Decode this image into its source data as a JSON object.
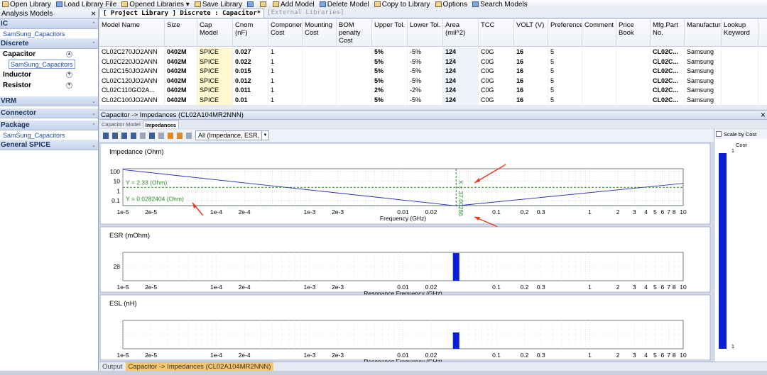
{
  "toolbar": {
    "items": [
      {
        "label": "Open Library",
        "icon": "folder-icon"
      },
      {
        "label": "Load Library File",
        "icon": "load-file-icon"
      },
      {
        "label": "Opened Libraries ▾",
        "icon": "libraries-icon"
      },
      {
        "label": "Save Library",
        "icon": "save-icon"
      },
      {
        "label": "",
        "icon": "split-view-icon"
      },
      {
        "label": "",
        "icon": "window-icon"
      },
      {
        "label": "Add Model",
        "icon": "add-model-icon"
      },
      {
        "label": "Delete Model",
        "icon": "delete-icon"
      },
      {
        "label": "Copy to Library",
        "icon": "copy-icon"
      },
      {
        "label": "Options",
        "icon": "options-icon"
      },
      {
        "label": "Search Models",
        "icon": "search-models-icon"
      }
    ]
  },
  "left": {
    "title": "Analysis Models",
    "close": "×",
    "groups": {
      "ic": {
        "label": "IC",
        "link": "SamSung_Capacitors"
      },
      "discrete": {
        "label": "Discrete",
        "capacitor": "Capacitor",
        "capacitor_link": "SamSung_Capacitors",
        "inductor": "Inductor",
        "resistor": "Resistor"
      },
      "vrm": {
        "label": "VRM"
      },
      "connector": {
        "label": "Connector"
      },
      "package": {
        "label": "Package",
        "link": "SamSung_Capacitors"
      },
      "general_spice": {
        "label": "General SPICE"
      }
    }
  },
  "tabs": {
    "project": "[ Project Library ] Discrete : Capacitor",
    "modified": "*",
    "external": "[External Libraries]"
  },
  "table": {
    "headers": [
      "Model Name",
      "Size",
      "Cap Model",
      "Cnom (nF)",
      "Component Cost",
      "Mounting Cost",
      "BOM penalty Cost",
      "Upper Tol.",
      "Lower Tol.",
      "Area (mil^2)",
      "TCC",
      "VOLT (V)",
      "Preference",
      "Comment",
      "Price Book",
      "Mfg.Part No.",
      "Manufacturer",
      "Lookup Keyword"
    ],
    "rows": [
      [
        "CL02C270JO2ANN",
        "0402M",
        "SPICE",
        "0.027",
        "1",
        "",
        "",
        "5%",
        "-5%",
        "124",
        "C0G",
        "16",
        "5",
        "",
        "",
        "CL02C...",
        "Samsung",
        ""
      ],
      [
        "CL02C220JO2ANN",
        "0402M",
        "SPICE",
        "0.022",
        "1",
        "",
        "",
        "5%",
        "-5%",
        "124",
        "C0G",
        "16",
        "5",
        "",
        "",
        "CL02C...",
        "Samsung",
        ""
      ],
      [
        "CL02C150JO2ANN",
        "0402M",
        "SPICE",
        "0.015",
        "1",
        "",
        "",
        "5%",
        "-5%",
        "124",
        "C0G",
        "16",
        "5",
        "",
        "",
        "CL02C...",
        "Samsung",
        ""
      ],
      [
        "CL02C120JO2ANN",
        "0402M",
        "SPICE",
        "0.012",
        "1",
        "",
        "",
        "5%",
        "-5%",
        "124",
        "C0G",
        "16",
        "5",
        "",
        "",
        "CL02C...",
        "Samsung",
        ""
      ],
      [
        "CL02C110GO2A...",
        "0402M",
        "SPICE",
        "0.011",
        "1",
        "",
        "",
        "2%",
        "-2%",
        "124",
        "C0G",
        "16",
        "5",
        "",
        "",
        "CL02C...",
        "Samsung",
        ""
      ],
      [
        "CL02C100JO2ANN",
        "0402M",
        "SPICE",
        "0.01",
        "1",
        "",
        "",
        "5%",
        "-5%",
        "124",
        "C0G",
        "16",
        "5",
        "",
        "",
        "CL02C...",
        "Samsung",
        ""
      ]
    ]
  },
  "subwindow": {
    "title": "Capacitor -> Impedances (CL02A104MR2NNN)",
    "close": "×",
    "tabs": [
      "Capacitor Model",
      "Impedances"
    ],
    "view_select": "All (Impedance, ESR,",
    "scale_by_cost": "Scale by Cost",
    "cost_label": "Cost",
    "cost_top": "1",
    "cost_bottom": "1"
  },
  "chart_data": [
    {
      "type": "line",
      "title": "Impedance (Ohm)",
      "xlabel": "Frequency (GHz)",
      "x_scale": "log",
      "y_scale": "log",
      "xlim": [
        1e-05,
        10
      ],
      "ylim": [
        0.03,
        200
      ],
      "x_ticks": [
        "1e-5",
        "2e-5",
        "1e-4",
        "2e-4",
        "1e-3",
        "2e-3",
        "0.01",
        "0.02",
        "0.1",
        "0.2",
        "0.3",
        "1",
        "2",
        "3",
        "4",
        "5",
        "6",
        "7",
        "8",
        "10"
      ],
      "y_ticks": [
        "100",
        "10",
        "1",
        "0.1"
      ],
      "series": [
        {
          "color": "#2b2bb8",
          "x": [
            1e-05,
            0.037,
            10
          ],
          "y": [
            160,
            0.0282,
            6
          ]
        }
      ],
      "cursor_x": 0.037,
      "cursor_label": "X = 37.00286",
      "cursor_y_label": "Y = 2.33 (Ohm)",
      "cursor_y2_label": "Y = 0.0282404 (Ohm)"
    },
    {
      "type": "bar",
      "title": "ESR (mOhm)",
      "xlabel": "Resonance Frequency (GHz)",
      "x_scale": "log",
      "xlim": [
        1e-05,
        10
      ],
      "y_ticks": [
        "28"
      ],
      "x": [
        0.037
      ],
      "values": [
        28
      ]
    },
    {
      "type": "bar",
      "title": "ESL (nH)",
      "xlabel": "Resonance Frequency (GHz)",
      "x_scale": "log",
      "xlim": [
        1e-05,
        10
      ],
      "x": [
        0.037
      ]
    }
  ],
  "bottom": {
    "tabs": [
      "Output",
      "Capacitor -> Impedances (CL02A104MR2NNN)"
    ]
  },
  "colors": {
    "accent": "#3c5f98",
    "trace": "#2b2bb8",
    "bar": "#0b1fd6",
    "cursor": "#2c8a2c",
    "annotation": "#e8371c"
  }
}
